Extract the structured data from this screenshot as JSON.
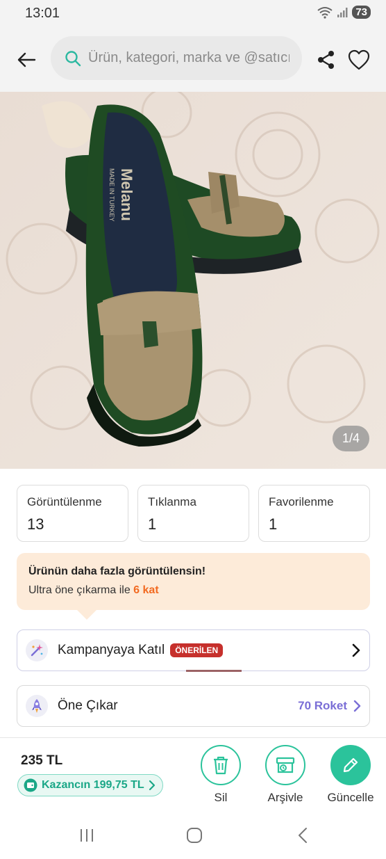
{
  "status_bar": {
    "time": "13:01",
    "battery": "73"
  },
  "header": {
    "search_placeholder": "Ürün, kategori, marka ve @satıcı ara"
  },
  "photo": {
    "counter": "1/4",
    "brand_print_1": "Melanu",
    "brand_print_2": "MADE IN TURKEY"
  },
  "stats": [
    {
      "label": "Görüntülenme",
      "value": "13"
    },
    {
      "label": "Tıklanma",
      "value": "1"
    },
    {
      "label": "Favorilenme",
      "value": "1"
    }
  ],
  "promo": {
    "title": "Ürünün daha fazla görüntülensin!",
    "sub_prefix": "Ultra öne çıkarma ile ",
    "sub_accent": "6 kat"
  },
  "campaign": {
    "label": "Kampanyaya Katıl",
    "badge": "ÖNERİLEN"
  },
  "highlight": {
    "label": "Öne Çıkar",
    "cost": "70 Roket"
  },
  "bottom": {
    "price": "235 TL",
    "earnings": "Kazancın 199,75 TL",
    "actions": {
      "delete": "Sil",
      "archive": "Arşivle",
      "update": "Güncelle"
    }
  },
  "colors": {
    "accent": "#2bc39b",
    "badge": "#c6302c",
    "promo_bg": "#fdebd9",
    "roket": "#7a6ed6"
  }
}
